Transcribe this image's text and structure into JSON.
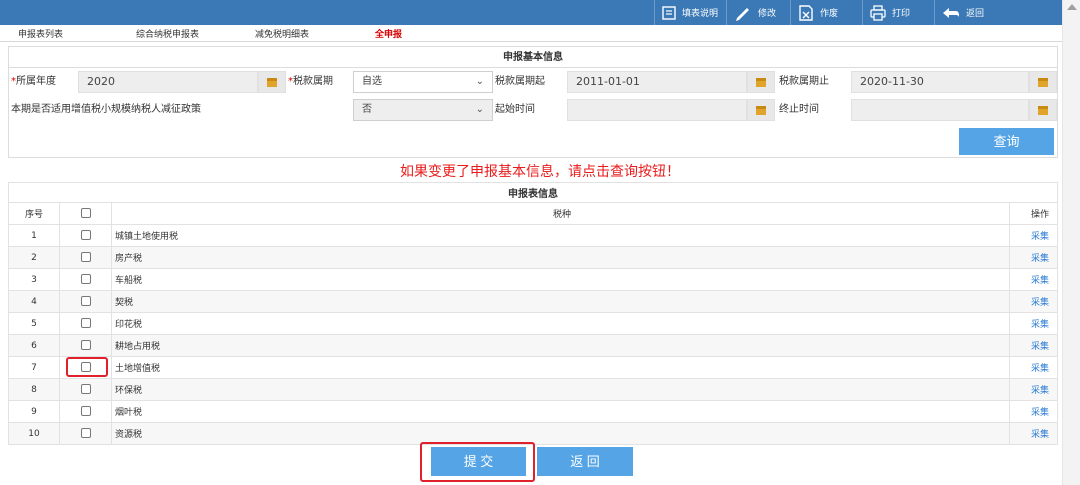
{
  "toolbar": {
    "fill_guide": "填表说明",
    "modify": "修改",
    "void": "作废",
    "print": "打印",
    "back": "返回"
  },
  "tabs": {
    "list": "申报表列表",
    "comprehensive": "综合纳税申报表",
    "exemption": "减免税明细表",
    "all": "全申报"
  },
  "basic_info": {
    "title": "申报基本信息",
    "year_label": "所属年度",
    "year_value": "2020",
    "period_label": "税款属期",
    "period_value": "自选",
    "start_label": "税款属期起",
    "start_value": "2011-01-01",
    "end_label": "税款属期止",
    "end_value": "2020-11-30",
    "policy_label": "本期是否适用增值税小规模纳税人减征政策",
    "policy_value": "否",
    "begin_time_label": "起始时间",
    "stop_time_label": "终止时间",
    "query_button": "查询"
  },
  "notice": "如果变更了申报基本信息，请点击查询按钮！",
  "table": {
    "title": "申报表信息",
    "col_index": "序号",
    "col_name": "税种",
    "col_op": "操作",
    "action": "采集",
    "rows": [
      {
        "index": "1",
        "name": "城镇土地使用税"
      },
      {
        "index": "2",
        "name": "房产税"
      },
      {
        "index": "3",
        "name": "车船税"
      },
      {
        "index": "4",
        "name": "契税"
      },
      {
        "index": "5",
        "name": "印花税"
      },
      {
        "index": "6",
        "name": "耕地占用税"
      },
      {
        "index": "7",
        "name": "土地增值税"
      },
      {
        "index": "8",
        "name": "环保税"
      },
      {
        "index": "9",
        "name": "烟叶税"
      },
      {
        "index": "10",
        "name": "资源税"
      }
    ]
  },
  "buttons": {
    "submit": "提 交",
    "return": "返 回"
  },
  "colors": {
    "toolbar": "#3a78b6",
    "button": "#55a4e6",
    "notice": "#ea1b1b",
    "highlight": "#e0202a"
  }
}
